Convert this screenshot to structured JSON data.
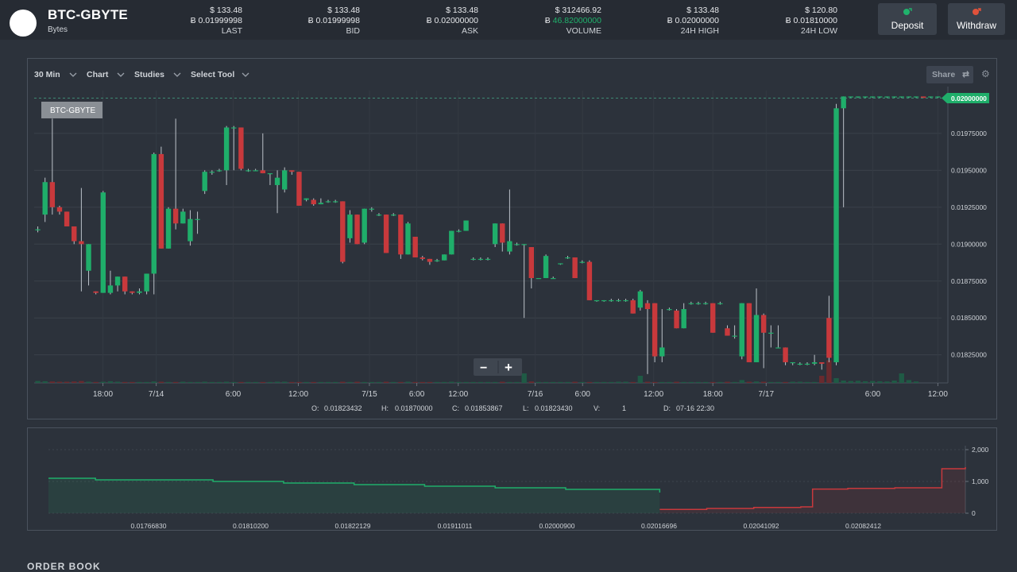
{
  "market": {
    "pair": "BTC-GBYTE",
    "currency": "Bytes"
  },
  "stats": [
    {
      "usd": "$ 133.48",
      "btc": "Ƀ 0.01999998",
      "label": "LAST"
    },
    {
      "usd": "$ 133.48",
      "btc": "Ƀ 0.01999998",
      "label": "BID"
    },
    {
      "usd": "$ 133.48",
      "btc": "Ƀ 0.02000000",
      "label": "ASK"
    },
    {
      "usd": "$ 312466.92",
      "btc_symbol": "Ƀ",
      "btc": "46.82000000",
      "label": "VOLUME"
    },
    {
      "usd": "$ 133.48",
      "btc": "Ƀ 0.02000000",
      "label": "24H HIGH"
    },
    {
      "usd": "$ 120.80",
      "btc": "Ƀ 0.01810000",
      "label": "24H LOW"
    }
  ],
  "actions": {
    "deposit": "Deposit",
    "withdraw": "Withdraw",
    "colors": {
      "deposit": "#20b26c",
      "withdraw": "#e0523b"
    }
  },
  "toolbar": {
    "interval": "30 Min",
    "chart": "Chart",
    "studies": "Studies",
    "select_tool": "Select Tool",
    "share": "Share"
  },
  "chart_data": [
    {
      "type": "candlestick",
      "symbol_label": "BTC-GBYTE",
      "last_price_label": "0.02000000",
      "y_ticks": [
        "0.01975000",
        "0.01950000",
        "0.01925000",
        "0.01900000",
        "0.01875000",
        "0.01850000",
        "0.01825000"
      ],
      "x_ticks": [
        "18:00",
        "7/14",
        "6:00",
        "12:00",
        "7/15",
        "6:00",
        "12:00",
        "7/16",
        "6:00",
        "12:00",
        "18:00",
        "7/17",
        "6:00",
        "12:00"
      ],
      "ylim": [
        0.01806,
        0.02004
      ],
      "grid": true,
      "colors": {
        "up": "#1fae6a",
        "down": "#c8393c"
      },
      "ohlc": [
        [
          0.0191,
          0.01912,
          0.01908,
          0.0191
        ],
        [
          0.0192,
          0.01945,
          0.01915,
          0.01942
        ],
        [
          0.01942,
          0.01985,
          0.0192,
          0.01925
        ],
        [
          0.01925,
          0.01926,
          0.0192,
          0.01922
        ],
        [
          0.01922,
          0.01922,
          0.01912,
          0.01912
        ],
        [
          0.01912,
          0.01912,
          0.019,
          0.01902
        ],
        [
          0.01902,
          0.01938,
          0.01868,
          0.019
        ],
        [
          0.01882,
          0.019,
          0.01872,
          0.019
        ],
        [
          0.01868,
          0.01868,
          0.01866,
          0.01867
        ],
        [
          0.01867,
          0.01936,
          0.01867,
          0.01935
        ],
        [
          0.01867,
          0.01882,
          0.01866,
          0.01872
        ],
        [
          0.01872,
          0.01878,
          0.01868,
          0.01878
        ],
        [
          0.01878,
          0.01878,
          0.01866,
          0.01868
        ],
        [
          0.01868,
          0.01868,
          0.01866,
          0.01867
        ],
        [
          0.01867,
          0.0187,
          0.01866,
          0.01868
        ],
        [
          0.01868,
          0.0188,
          0.01866,
          0.0188
        ],
        [
          0.0188,
          0.01962,
          0.01866,
          0.01961
        ],
        [
          0.01961,
          0.01966,
          0.01897,
          0.01897
        ],
        [
          0.01897,
          0.01925,
          0.01897,
          0.01924
        ],
        [
          0.01924,
          0.01985,
          0.0191,
          0.01914
        ],
        [
          0.01914,
          0.01924,
          0.01914,
          0.01922
        ],
        [
          0.01902,
          0.01923,
          0.01899,
          0.01917
        ],
        [
          0.01917,
          0.01922,
          0.01907,
          0.01917
        ],
        [
          0.01936,
          0.0195,
          0.01934,
          0.01949
        ],
        [
          0.01949,
          0.0195,
          0.01947,
          0.01949
        ],
        [
          0.0195,
          0.01951,
          0.01949,
          0.0195
        ],
        [
          0.0195,
          0.0198,
          0.0194,
          0.01979
        ],
        [
          0.01979,
          0.0198,
          0.0195,
          0.01979
        ],
        [
          0.01979,
          0.01979,
          0.0195,
          0.01951
        ],
        [
          0.0195,
          0.01951,
          0.01949,
          0.0195
        ],
        [
          0.0195,
          0.01951,
          0.0195,
          0.0195
        ],
        [
          0.0195,
          0.01975,
          0.01948,
          0.01948
        ],
        [
          0.01948,
          0.01948,
          0.0194,
          0.01948
        ],
        [
          0.0194,
          0.0195,
          0.01921,
          0.01945
        ],
        [
          0.01937,
          0.01952,
          0.01935,
          0.0195
        ],
        [
          0.0195,
          0.0195,
          0.01947,
          0.01949
        ],
        [
          0.01949,
          0.01949,
          0.01926,
          0.01926
        ],
        [
          0.0193,
          0.01931,
          0.01929,
          0.01931
        ],
        [
          0.0193,
          0.01931,
          0.01926,
          0.01927
        ],
        [
          0.01927,
          0.01931,
          0.01927,
          0.01928
        ],
        [
          0.01929,
          0.0193,
          0.01928,
          0.01929
        ],
        [
          0.01929,
          0.0193,
          0.01928,
          0.01929
        ],
        [
          0.01929,
          0.01929,
          0.01887,
          0.01888
        ],
        [
          0.01904,
          0.01923,
          0.01901,
          0.0192
        ],
        [
          0.0192,
          0.0192,
          0.019,
          0.019
        ],
        [
          0.01901,
          0.01924,
          0.019,
          0.01924
        ],
        [
          0.01924,
          0.01925,
          0.01922,
          0.01924
        ],
        [
          0.0192,
          0.01921,
          0.01919,
          0.0192
        ],
        [
          0.0192,
          0.0192,
          0.01894,
          0.01894
        ],
        [
          0.0192,
          0.01921,
          0.01919,
          0.0192
        ],
        [
          0.0192,
          0.0192,
          0.0189,
          0.01893
        ],
        [
          0.01893,
          0.01915,
          0.01893,
          0.01914
        ],
        [
          0.01905,
          0.01905,
          0.01891,
          0.01891
        ],
        [
          0.01891,
          0.01892,
          0.01889,
          0.0189
        ],
        [
          0.0189,
          0.0189,
          0.01886,
          0.01888
        ],
        [
          0.01889,
          0.0189,
          0.01888,
          0.01889
        ],
        [
          0.01889,
          0.01893,
          0.01889,
          0.01893
        ],
        [
          0.01893,
          0.01909,
          0.01893,
          0.01909
        ],
        [
          0.01909,
          0.0191,
          0.01908,
          0.01909
        ],
        [
          0.01909,
          0.01916,
          0.01909,
          0.01916
        ],
        [
          0.0189,
          0.01891,
          0.01889,
          0.0189
        ],
        [
          0.0189,
          0.01891,
          0.01889,
          0.0189
        ],
        [
          0.0189,
          0.01891,
          0.01889,
          0.0189
        ],
        [
          0.019,
          0.01914,
          0.01898,
          0.01914
        ],
        [
          0.01914,
          0.01914,
          0.01895,
          0.01901
        ],
        [
          0.01895,
          0.01937,
          0.01893,
          0.01902
        ],
        [
          0.019,
          0.01901,
          0.01899,
          0.019
        ],
        [
          0.019,
          0.019,
          0.0185,
          0.019
        ],
        [
          0.01898,
          0.01898,
          0.0187,
          0.01877
        ],
        [
          0.01877,
          0.01877,
          0.01877,
          0.01877
        ],
        [
          0.01877,
          0.01893,
          0.01877,
          0.01892
        ],
        [
          0.01877,
          0.01878,
          0.01877,
          0.01877
        ],
        [
          0.01887,
          0.01887,
          0.01886,
          0.01887
        ],
        [
          0.01891,
          0.01892,
          0.0189,
          0.01891
        ],
        [
          0.01891,
          0.01891,
          0.01877,
          0.01877
        ],
        [
          0.01888,
          0.01889,
          0.01887,
          0.01888
        ],
        [
          0.01888,
          0.01889,
          0.01862,
          0.01862
        ],
        [
          0.01862,
          0.01862,
          0.01861,
          0.01862
        ],
        [
          0.01862,
          0.01862,
          0.01861,
          0.01862
        ],
        [
          0.01862,
          0.01863,
          0.01861,
          0.01862
        ],
        [
          0.01862,
          0.01863,
          0.01861,
          0.01862
        ],
        [
          0.01862,
          0.01863,
          0.01861,
          0.01862
        ],
        [
          0.01862,
          0.01863,
          0.01853,
          0.01853
        ],
        [
          0.01857,
          0.01869,
          0.01855,
          0.01868
        ],
        [
          0.0186,
          0.01862,
          0.01812,
          0.01856
        ],
        [
          0.0186,
          0.0186,
          0.0182,
          0.01824
        ],
        [
          0.01824,
          0.01856,
          0.0182,
          0.0183
        ],
        [
          0.01856,
          0.01857,
          0.01855,
          0.01856
        ],
        [
          0.01855,
          0.01856,
          0.01843,
          0.01843
        ],
        [
          0.01843,
          0.0186,
          0.01843,
          0.01856
        ],
        [
          0.0186,
          0.01861,
          0.01859,
          0.0186
        ],
        [
          0.0186,
          0.01861,
          0.01859,
          0.0186
        ],
        [
          0.0186,
          0.01861,
          0.01859,
          0.0186
        ],
        [
          0.0186,
          0.0186,
          0.0184,
          0.0184
        ],
        [
          0.0186,
          0.01861,
          0.01859,
          0.0186
        ],
        [
          0.01843,
          0.01845,
          0.01838,
          0.01838
        ],
        [
          0.01838,
          0.01845,
          0.01836,
          0.01838
        ],
        [
          0.01824,
          0.0186,
          0.01822,
          0.0186
        ],
        [
          0.0186,
          0.0186,
          0.0182,
          0.0182
        ],
        [
          0.0182,
          0.0187,
          0.0182,
          0.01852
        ],
        [
          0.01852,
          0.01853,
          0.01816,
          0.0184
        ],
        [
          0.0184,
          0.01845,
          0.0183,
          0.0184
        ],
        [
          0.0183,
          0.01845,
          0.0183,
          0.0183
        ],
        [
          0.0183,
          0.0183,
          0.01818,
          0.0182
        ],
        [
          0.0182,
          0.0182,
          0.01818,
          0.0182
        ],
        [
          0.01819,
          0.0182,
          0.01818,
          0.01819
        ],
        [
          0.01819,
          0.0182,
          0.01818,
          0.01819
        ],
        [
          0.01819,
          0.01825,
          0.01818,
          0.0182
        ],
        [
          0.0182,
          0.0182,
          0.01815,
          0.01819
        ],
        [
          0.0185,
          0.01865,
          0.0182,
          0.01823
        ],
        [
          0.0182,
          0.01995,
          0.01818,
          0.01992
        ],
        [
          0.01992,
          0.02,
          0.01925,
          0.02
        ],
        [
          0.02,
          0.02,
          0.01999,
          0.02
        ],
        [
          0.02,
          0.02,
          0.01999,
          0.02
        ],
        [
          0.02,
          0.02,
          0.01999,
          0.02
        ],
        [
          0.02,
          0.02,
          0.01999,
          0.02
        ],
        [
          0.02,
          0.02,
          0.01999,
          0.02
        ],
        [
          0.02,
          0.02,
          0.01999,
          0.02
        ],
        [
          0.02,
          0.02,
          0.01999,
          0.02
        ],
        [
          0.02,
          0.02,
          0.01999,
          0.02
        ],
        [
          0.02,
          0.02,
          0.01999,
          0.02
        ],
        [
          0.02,
          0.02,
          0.01999,
          0.02
        ],
        [
          0.02,
          0.02,
          0.01999,
          0.01999
        ],
        [
          0.02,
          0.02,
          0.01999,
          0.02
        ],
        [
          0.02,
          0.02,
          0.01999,
          0.02
        ]
      ],
      "volume_ratio": [
        0.08,
        0.07,
        0.06,
        0.05,
        0.05,
        0.06,
        0.08,
        0.05,
        0.04,
        0.05,
        0.07,
        0.05,
        0.04,
        0.04,
        0.04,
        0.04,
        0.06,
        0.05,
        0.04,
        0.04,
        0.05,
        0.04,
        0.04,
        0.05,
        0.04,
        0.04,
        0.05,
        0.04,
        0.04,
        0.04,
        0.04,
        0.04,
        0.04,
        0.05,
        0.05,
        0.04,
        0.04,
        0.04,
        0.04,
        0.04,
        0.04,
        0.04,
        0.05,
        0.04,
        0.05,
        0.04,
        0.04,
        0.04,
        0.05,
        0.04,
        0.04,
        0.05,
        0.04,
        0.04,
        0.04,
        0.04,
        0.04,
        0.05,
        0.04,
        0.04,
        0.04,
        0.04,
        0.04,
        0.04,
        0.05,
        0.04,
        0.04,
        0.4,
        0.06,
        0.04,
        0.04,
        0.04,
        0.04,
        0.04,
        0.05,
        0.04,
        0.04,
        0.04,
        0.04,
        0.04,
        0.05,
        0.05,
        0.04,
        0.3,
        0.05,
        0.04,
        0.04,
        0.04,
        0.05,
        0.04,
        0.04,
        0.04,
        0.04,
        0.04,
        0.04,
        0.05,
        0.04,
        0.12,
        0.05,
        0.06,
        0.05,
        0.04,
        0.04,
        0.04,
        0.05,
        0.05,
        0.04,
        0.04,
        0.3,
        0.95,
        0.2,
        0.1,
        0.08,
        0.09,
        0.07,
        0.08,
        0.07,
        0.06,
        0.1,
        0.4,
        0.12,
        0.06
      ]
    },
    {
      "type": "area",
      "name": "depth",
      "y_ticks": [
        "2,000",
        "1,000",
        "0"
      ],
      "x_ticks": [
        "0.01766830",
        "0.01810200",
        "0.01822129",
        "0.01911011",
        "0.02000900",
        "0.02016696",
        "0.02041092",
        "0.02082412"
      ],
      "ylim": [
        0,
        2000
      ],
      "colors": {
        "bids": "#1fae6a",
        "asks": "#c8393c"
      },
      "bids": [
        [
          0.0174,
          1100
        ],
        [
          0.0176,
          1050
        ],
        [
          0.0181,
          1000
        ],
        [
          0.0184,
          950
        ],
        [
          0.0187,
          900
        ],
        [
          0.019,
          850
        ],
        [
          0.0193,
          800
        ],
        [
          0.0196,
          750
        ],
        [
          0.01999998,
          650
        ]
      ],
      "asks": [
        [
          0.02,
          120
        ],
        [
          0.0202,
          150
        ],
        [
          0.0204,
          180
        ],
        [
          0.0206,
          200
        ],
        [
          0.02065,
          760
        ],
        [
          0.0208,
          780
        ],
        [
          0.021,
          800
        ],
        [
          0.0212,
          1400
        ],
        [
          0.0213,
          1450
        ]
      ]
    }
  ],
  "ohlc_readout": {
    "o_label": "O:",
    "o": "0.01823432",
    "h_label": "H:",
    "h": "0.01870000",
    "c_label": "C:",
    "c": "0.01853867",
    "l_label": "L:",
    "l": "0.01823430",
    "v_label": "V:",
    "v": "1",
    "d_label": "D:",
    "d": "07-16 22:30"
  },
  "zoom": {
    "minus": "−",
    "plus": "+"
  },
  "order_book": {
    "title": "ORDER BOOK"
  }
}
